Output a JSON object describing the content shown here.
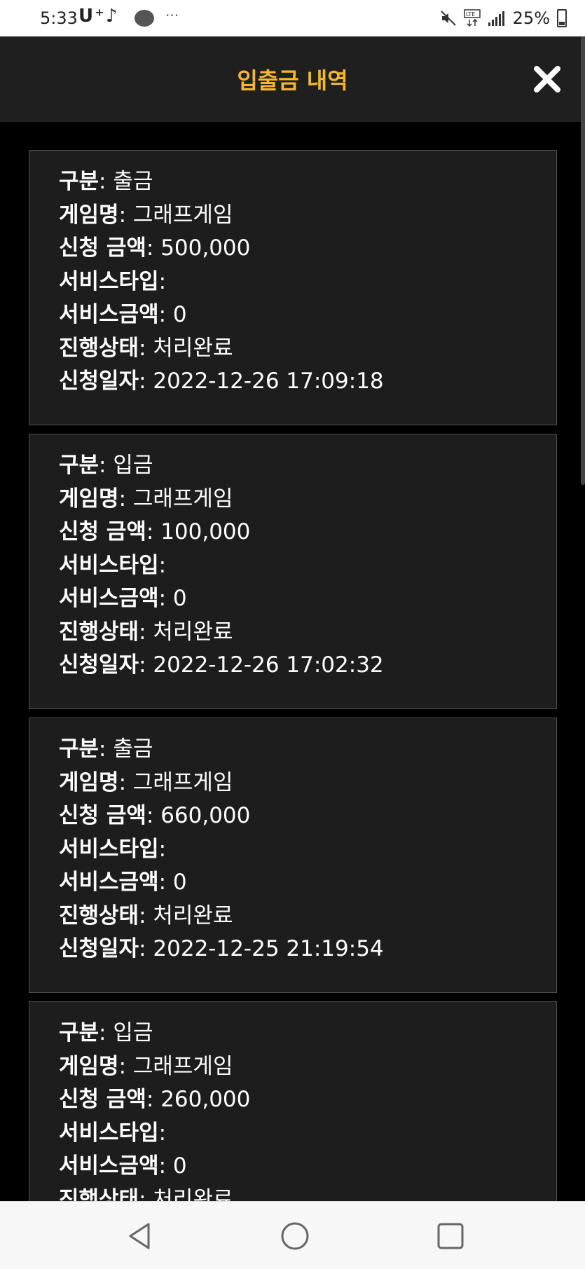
{
  "status_bar": {
    "time": "5:33",
    "apps": "U⁺♪",
    "battery": "25%",
    "icons": [
      "talk-icon",
      "mute-icon",
      "lte-icon",
      "signal-icon",
      "battery-icon"
    ]
  },
  "header": {
    "title": "입출금 내역",
    "close_icon": "close-icon",
    "title_color": "#f5b72b"
  },
  "labels": {
    "type": "구분",
    "game": "게임명",
    "amount": "신청 금액",
    "service_type": "서비스타입",
    "service_amount": "서비스금액",
    "status": "진행상태",
    "date": "신청일자"
  },
  "records": [
    {
      "type": "출금",
      "game": "그래프게임",
      "amount": "500,000",
      "service_type": "",
      "service_amount": "0",
      "status": "처리완료",
      "date": "2022-12-26 17:09:18"
    },
    {
      "type": "입금",
      "game": "그래프게임",
      "amount": "100,000",
      "service_type": "",
      "service_amount": "0",
      "status": "처리완료",
      "date": "2022-12-26 17:02:32"
    },
    {
      "type": "출금",
      "game": "그래프게임",
      "amount": "660,000",
      "service_type": "",
      "service_amount": "0",
      "status": "처리완료",
      "date": "2022-12-25 21:19:54"
    },
    {
      "type": "입금",
      "game": "그래프게임",
      "amount": "260,000",
      "service_type": "",
      "service_amount": "0",
      "status": "처리완료",
      "date": ""
    }
  ],
  "navbar": {
    "icons": [
      "back-icon",
      "home-icon",
      "recents-icon"
    ]
  }
}
